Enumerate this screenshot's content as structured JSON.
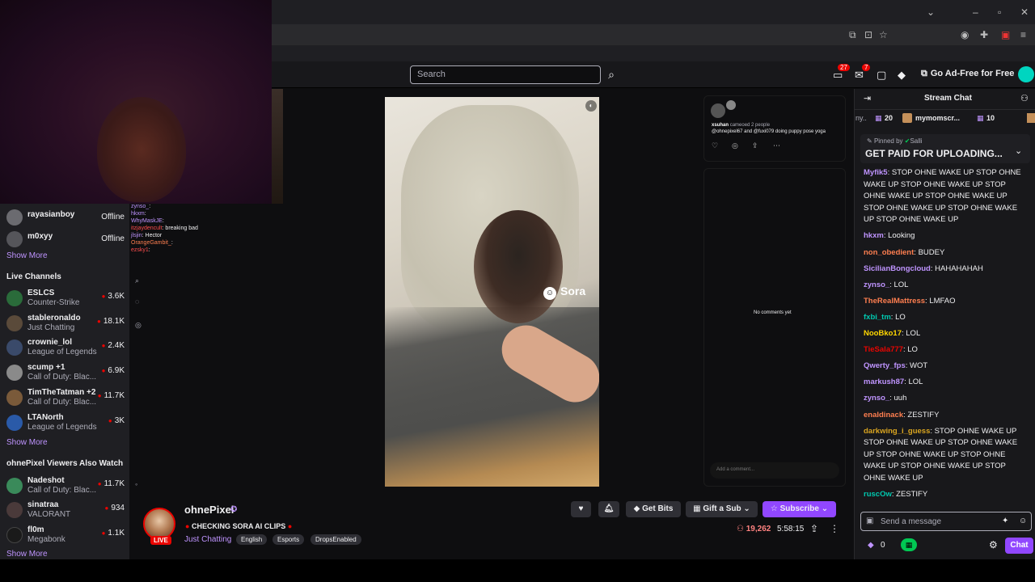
{
  "search": {
    "placeholder": "Search"
  },
  "topnav": {
    "notif_count": "27",
    "inbox_count": "7",
    "ad_free": "Go Ad-Free for Free"
  },
  "sidebar": {
    "followed": [
      {
        "name": "rayasianboy",
        "status": "Offline",
        "color": "#6b6b70"
      },
      {
        "name": "m0xyy",
        "status": "Offline",
        "color": "#55555a"
      }
    ],
    "show_more_1": "Show More",
    "live_header": "Live Channels",
    "live": [
      {
        "name": "ESLCS",
        "category": "Counter-Strike",
        "viewers": "3.6K",
        "color": "#2a6b3a"
      },
      {
        "name": "stableronaldo",
        "category": "Just Chatting",
        "viewers": "18.1K",
        "color": "#5a4a3a"
      },
      {
        "name": "crownie_lol",
        "category": "League of Legends",
        "viewers": "2.4K",
        "color": "#3a4a6a"
      },
      {
        "name": "scump +1",
        "category": "Call of Duty: Blac...",
        "viewers": "6.9K",
        "color": "#8a8a8a"
      },
      {
        "name": "TimTheTatman +2",
        "category": "Call of Duty: Blac...",
        "viewers": "11.7K",
        "color": "#7a5a3a"
      },
      {
        "name": "LTANorth",
        "category": "League of Legends",
        "viewers": "3K",
        "color": "#2a5aa8"
      }
    ],
    "show_more_2": "Show More",
    "also_header": "ohnePixel Viewers Also Watch",
    "also": [
      {
        "name": "Nadeshot",
        "category": "Call of Duty: Blac...",
        "viewers": "11.7K",
        "color": "#3a8a5a"
      },
      {
        "name": "sinatraa",
        "category": "VALORANT",
        "viewers": "934",
        "color": "#4a3a3a"
      },
      {
        "name": "fl0m",
        "category": "Megabonk",
        "viewers": "1.1K",
        "color": "#1a1a1a"
      }
    ],
    "show_more_3": "Show More"
  },
  "minichat": [
    {
      "user": "zynso_",
      "msg": "",
      "color": "#bf94ff"
    },
    {
      "user": "hkxm",
      "msg": "",
      "color": "#bf94ff"
    },
    {
      "user": "WhyMaskJE",
      "msg": "",
      "color": "#bf94ff"
    },
    {
      "user": "itzjaydencult",
      "msg": "breaking bad",
      "color": "#ff4d4d"
    },
    {
      "user": "jlsjin",
      "msg": "Hector",
      "color": "#bf94ff"
    },
    {
      "user": "OrangeGambit_",
      "msg": "",
      "color": "#ff7f50"
    },
    {
      "user": "ezsky1",
      "msg": "",
      "color": "#ff4d4d"
    }
  ],
  "sora": {
    "watermark": "Sora",
    "user": "xsuhan",
    "cameo_text": "cameoed 2 people",
    "caption": "@ohnepixel67 and @fuxi079 doing puppy pose yoga",
    "no_comments": "No comments yet",
    "add_comment": "Add a comment..."
  },
  "stream": {
    "live": "LIVE",
    "name": "ohnePixel",
    "title": "CHECKING SORA AI CLIPS",
    "category": "Just Chatting",
    "tags": [
      "English",
      "Esports",
      "DropsEnabled"
    ],
    "get_bits": "Get Bits",
    "gift_sub": "Gift a Sub",
    "subscribe": "Subscribe",
    "viewers": "19,262",
    "uptime": "5:58:15"
  },
  "chat": {
    "title": "Stream Chat",
    "gift_left_count": "20",
    "gift_user": "mymomscr...",
    "gift_right_count": "10",
    "pinned_by": "Pinned by",
    "pinned_by_user": "Salli",
    "pinned_msg": "GET PAID FOR UPLOADING...",
    "messages": [
      {
        "user": "Myfik5",
        "color": "#bf94ff",
        "msg": "STOP OHNE WAKE UP STOP OHNE WAKE UP STOP OHNE WAKE UP STOP OHNE WAKE UP STOP OHNE WAKE UP STOP OHNE WAKE UP STOP OHNE WAKE UP STOP OHNE WAKE UP"
      },
      {
        "user": "hkxm",
        "color": "#bf94ff",
        "msg": "Looking"
      },
      {
        "user": "non_obedient",
        "color": "#ff7f50",
        "msg": "BUDEY"
      },
      {
        "user": "SicilianBongcloud",
        "color": "#bf94ff",
        "msg": "HAHAHAHAH"
      },
      {
        "user": "zynso_",
        "color": "#bf94ff",
        "msg": "LOL"
      },
      {
        "user": "TheRealMattress",
        "color": "#ff7f50",
        "msg": "LMFAO"
      },
      {
        "user": "fxbi_tm",
        "color": "#00c8af",
        "msg": "LO"
      },
      {
        "user": "NooBko17",
        "color": "#ffd700",
        "msg": "LOL"
      },
      {
        "user": "TieSala777",
        "color": "#eb0400",
        "msg": "LO"
      },
      {
        "user": "Qwerty_fps",
        "color": "#bf94ff",
        "msg": "WOT"
      },
      {
        "user": "markush87",
        "color": "#bf94ff",
        "msg": "LOL"
      },
      {
        "user": "zynso_",
        "color": "#bf94ff",
        "msg": "uuh"
      },
      {
        "user": "enaldinack",
        "color": "#ff7f50",
        "msg": "ZESTIFY"
      },
      {
        "user": "darkwing_i_guess",
        "color": "#daa520",
        "msg": "STOP OHNE WAKE UP STOP OHNE WAKE UP STOP OHNE WAKE UP STOP OHNE WAKE UP STOP OHNE WAKE UP STOP OHNE WAKE UP STOP OHNE WAKE UP"
      },
      {
        "user": "ruscOw",
        "color": "#00c8af",
        "msg": "ZESTIFY"
      }
    ],
    "input_placeholder": "Send a message",
    "points": "0",
    "chat_button": "Chat"
  }
}
